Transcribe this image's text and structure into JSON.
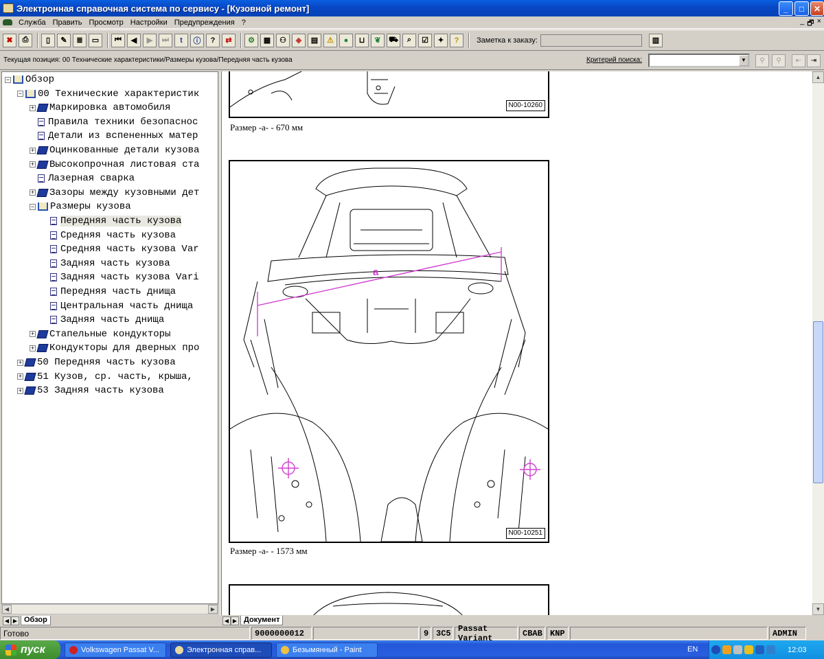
{
  "window": {
    "title": "Электронная справочная система по сервису - [Кузовной ремонт]"
  },
  "menu": [
    "Служба",
    "Править",
    "Просмотр",
    "Настройки",
    "Предупреждения",
    "?"
  ],
  "mdi_buttons": [
    "_",
    "🗗",
    "×"
  ],
  "toolbar": {
    "note_label": "Заметка к заказу:",
    "note_value": ""
  },
  "position": {
    "text": "Текущая позиция: 00 Технические характеристики/Размеры кузова/Передняя часть кузова",
    "criteria_label": "Критерий поиска:",
    "criteria_value": ""
  },
  "tree": {
    "nodes": [
      {
        "label": "Обзор",
        "level": 0
      },
      {
        "label": "00 Технические характеристик",
        "level": 1
      },
      {
        "label": "Маркировка автомобиля",
        "level": 2
      },
      {
        "label": "Правила техники безопаснос",
        "level": 2
      },
      {
        "label": "Детали из вспененных матер",
        "level": 2
      },
      {
        "label": "Оцинкованные детали кузова",
        "level": 2
      },
      {
        "label": "Высокопрочная листовая ста",
        "level": 2
      },
      {
        "label": "Лазерная сварка",
        "level": 2
      },
      {
        "label": "Зазоры между кузовными дет",
        "level": 2
      },
      {
        "label": "Размеры кузова",
        "level": 2
      },
      {
        "label": "Передняя часть кузова",
        "level": 3
      },
      {
        "label": "Средняя часть кузова",
        "level": 3
      },
      {
        "label": "Средняя часть кузова Var",
        "level": 3
      },
      {
        "label": "Задняя часть кузова",
        "level": 3
      },
      {
        "label": "Задняя часть кузова Vari",
        "level": 3
      },
      {
        "label": "Передняя часть днища",
        "level": 3
      },
      {
        "label": "Центральная часть днища",
        "level": 3
      },
      {
        "label": "Задняя часть днища",
        "level": 3
      },
      {
        "label": "Стапельные кондукторы",
        "level": 2
      },
      {
        "label": "Кондукторы для дверных про",
        "level": 2
      },
      {
        "label": "50 Передняя часть кузова",
        "level": 1
      },
      {
        "label": "51 Кузов, ср. часть, крыша,",
        "level": 1
      },
      {
        "label": "53 Задняя часть кузова",
        "level": 1
      }
    ],
    "tab": "Обзор"
  },
  "document": {
    "tab": "Документ",
    "fig1_id": "N00-10260",
    "caption1": "Размер -a- - 670 мм",
    "fig2_id": "N00-10251",
    "caption2": "Размер -a- - 1573 мм",
    "dim_label": "a"
  },
  "status": {
    "text": "Готово",
    "code": "9000000012",
    "f1": "9",
    "f2": "3C5",
    "f3": "Passat Variant",
    "f4": "CBAB",
    "f5": "KNP",
    "user": "ADMIN"
  },
  "taskbar": {
    "start": "пуск",
    "tasks": [
      "Volkswagen Passat V...",
      "Электронная справ...",
      "Безымянный - Paint"
    ],
    "lang": "EN",
    "clock": "12:03"
  },
  "colors": {
    "title": "#0a5fe0",
    "dimension": "#d040d0",
    "taskbar": "#2458d8"
  }
}
